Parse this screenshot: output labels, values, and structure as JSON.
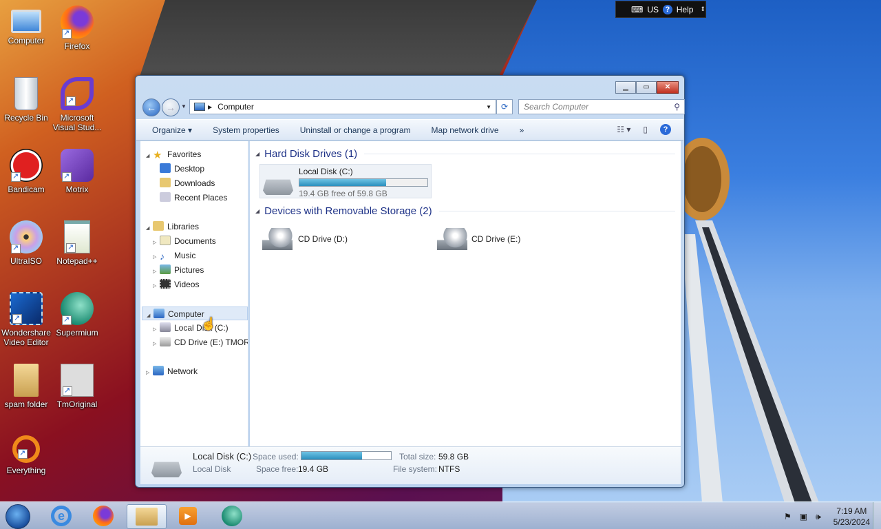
{
  "langbar": {
    "lang": "US",
    "help": "Help"
  },
  "desktop_icons": [
    {
      "label": "Computer"
    },
    {
      "label": "Firefox"
    },
    {
      "label": "Recycle Bin"
    },
    {
      "label": "Microsoft Visual Stud..."
    },
    {
      "label": "Bandicam"
    },
    {
      "label": "Motrix"
    },
    {
      "label": "UltraISO"
    },
    {
      "label": "Notepad++"
    },
    {
      "label": "Wondershare Video Editor"
    },
    {
      "label": "Supermium"
    },
    {
      "label": "spam folder"
    },
    {
      "label": "TmOriginal"
    },
    {
      "label": "Everything"
    }
  ],
  "window": {
    "address": "Computer",
    "search_placeholder": "Search Computer",
    "toolbar": {
      "organize": "Organize",
      "system_properties": "System properties",
      "uninstall": "Uninstall or change a program",
      "map_drive": "Map network drive",
      "more": "»"
    },
    "nav": {
      "favorites": "Favorites",
      "desktop": "Desktop",
      "downloads": "Downloads",
      "recent": "Recent Places",
      "libraries": "Libraries",
      "documents": "Documents",
      "music": "Music",
      "pictures": "Pictures",
      "videos": "Videos",
      "computer": "Computer",
      "local_disk": "Local Disk (C:)",
      "cd_drive_e": "CD Drive (E:) TMORI",
      "network": "Network"
    },
    "groups": {
      "hard_disk": "Hard Disk Drives (1)",
      "removable": "Devices with Removable Storage (2)"
    },
    "drives": {
      "c": {
        "label": "Local Disk (C:)",
        "free_text": "19.4 GB free of 59.8 GB",
        "used_fraction": 0.676
      },
      "d": {
        "label": "CD Drive (D:)"
      },
      "e": {
        "label": "CD Drive (E:)"
      }
    },
    "details": {
      "name": "Local Disk (C:)",
      "type": "Local Disk",
      "space_used_label": "Space used:",
      "space_free_label": "Space free:",
      "space_free": "19.4 GB",
      "total_size_label": "Total size:",
      "total_size": "59.8 GB",
      "file_system_label": "File system:",
      "file_system": "NTFS",
      "used_fraction": 0.676
    }
  },
  "taskbar": {
    "time": "7:19 AM",
    "date": "5/23/2024"
  }
}
